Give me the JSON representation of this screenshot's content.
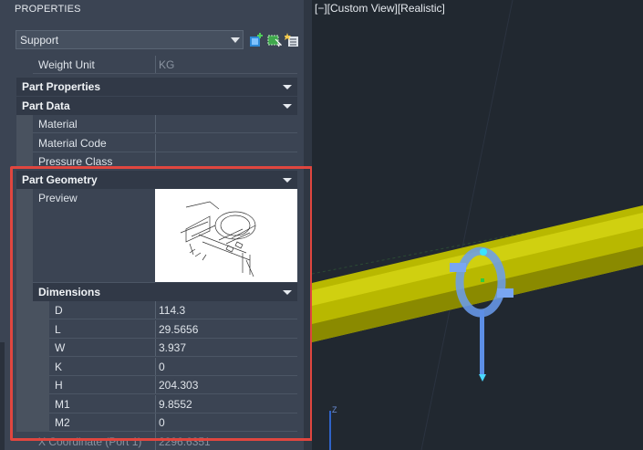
{
  "palette": {
    "title": "PROPERTIES",
    "object_type": "Support",
    "tools": [
      "quick-select-icon",
      "select-objects-icon",
      "toggle-pickadd-icon"
    ]
  },
  "rows": {
    "weight_unit": {
      "label": "Weight Unit",
      "value": "KG"
    },
    "part_properties": "Part Properties",
    "part_data": "Part Data",
    "material": {
      "label": "Material",
      "value": ""
    },
    "material_code": {
      "label": "Material Code",
      "value": ""
    },
    "pressure_class": {
      "label": "Pressure Class",
      "value": ""
    },
    "part_geometry": "Part Geometry",
    "preview": "Preview",
    "dimensions": "Dimensions",
    "x_coordinate": {
      "label": "X Coordinate (Port 1)",
      "value": "2296.6351"
    }
  },
  "dimensions": [
    {
      "label": "D",
      "value": "114.3"
    },
    {
      "label": "L",
      "value": "29.5656"
    },
    {
      "label": "W",
      "value": "3.937"
    },
    {
      "label": "K",
      "value": "0"
    },
    {
      "label": "H",
      "value": "204.303"
    },
    {
      "label": "M1",
      "value": "9.8552"
    },
    {
      "label": "M2",
      "value": "0"
    }
  ],
  "viewport": {
    "label": "[−][Custom View][Realistic]",
    "axis_label": "Z"
  },
  "colors": {
    "highlight": "#e0463f",
    "pipe": "#c4c400",
    "support": "#5d8fe6"
  }
}
